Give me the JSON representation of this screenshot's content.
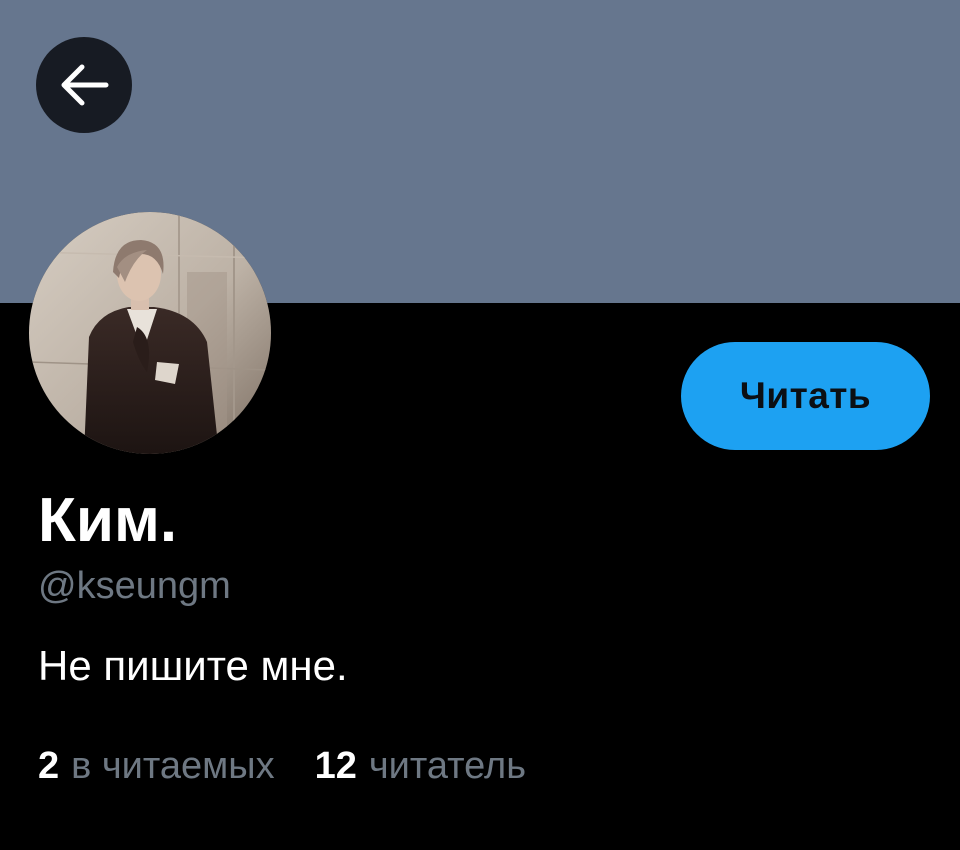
{
  "profile": {
    "display_name": "Ким.",
    "handle": "@kseungm",
    "bio": "Не пишите мне.",
    "follow_label": "Читать",
    "stats": {
      "following_count": "2",
      "following_label": "в читаемых",
      "followers_count": "12",
      "followers_label": "читатель"
    }
  },
  "icons": {
    "back": "arrow-left-icon"
  },
  "colors": {
    "banner": "#66768e",
    "background": "#000000",
    "accent": "#1da1f2",
    "secondary_text": "#6e7883",
    "back_button_bg": "#171b23"
  }
}
